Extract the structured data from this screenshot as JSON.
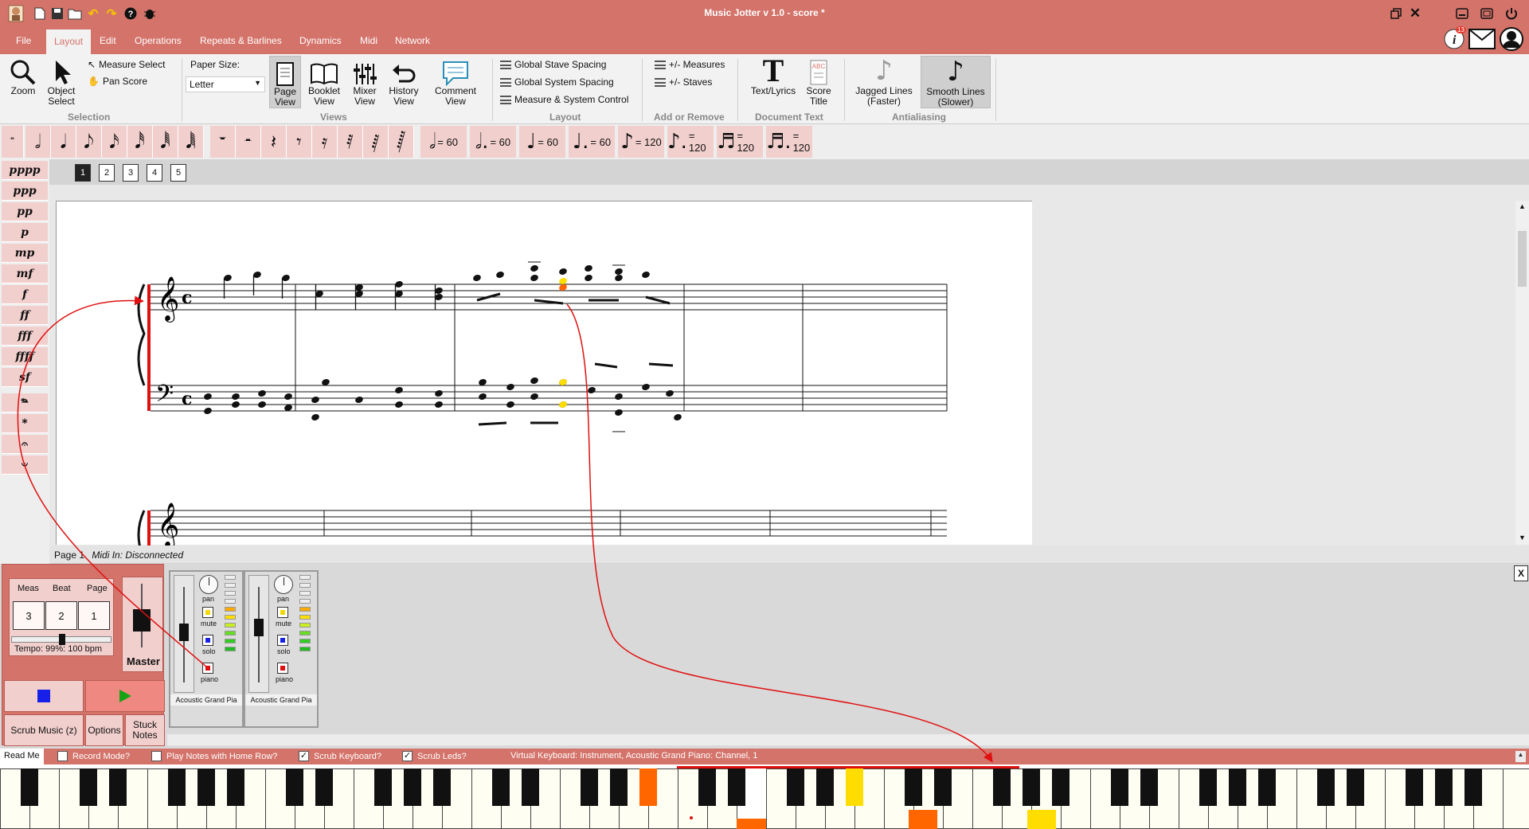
{
  "app": {
    "title": "Music Jotter v 1.0 - score *"
  },
  "menu": {
    "items": [
      "File",
      "Layout",
      "Edit",
      "Operations",
      "Repeats & Barlines",
      "Dynamics",
      "Midi",
      "Network"
    ],
    "active": "Layout"
  },
  "ribbon": {
    "zoom": "Zoom",
    "object_select_1": "Object",
    "object_select_2": "Select",
    "measure_select": "Measure Select",
    "pan_score": "Pan Score",
    "group_selection": "Selection",
    "paper_size_label": "Paper Size:",
    "paper_size_value": "Letter",
    "page_view_1": "Page",
    "page_view_2": "View",
    "booklet_view_1": "Booklet",
    "booklet_view_2": "View",
    "mixer_view_1": "Mixer",
    "mixer_view_2": "View",
    "history_view_1": "History",
    "history_view_2": "View",
    "comment_view_1": "Comment",
    "comment_view_2": "View",
    "group_views": "Views",
    "global_stave_spacing": "Global Stave Spacing",
    "global_system_spacing": "Global System Spacing",
    "measure_system_control": "Measure & System Control",
    "group_layout": "Layout",
    "add_measures": "+/- Measures",
    "add_staves": "+/- Staves",
    "group_add_remove": "Add or Remove",
    "text_lyrics": "Text/Lyrics",
    "score_title_1": "Score",
    "score_title_2": "Title",
    "group_document_text": "Document Text",
    "jagged_1": "Jagged Lines",
    "jagged_2": "(Faster)",
    "smooth_1": "Smooth Lines",
    "smooth_2": "(Slower)",
    "group_antialiasing": "Antialiasing",
    "notification_count": "13"
  },
  "note_strip": {
    "tempos": [
      {
        "glyph": "𝅗𝅥",
        "text": "= 60"
      },
      {
        "glyph": "𝅗𝅥.",
        "text": "= 60"
      },
      {
        "glyph": "♩",
        "text": "= 60"
      },
      {
        "glyph": "♩.",
        "text": "= 60"
      },
      {
        "glyph": "♪",
        "text": "= 120"
      },
      {
        "glyph": "♪.",
        "text": "= 120"
      },
      {
        "glyph": "♬",
        "text": "= 120"
      },
      {
        "glyph": "♬.",
        "text": "= 120"
      }
    ]
  },
  "dynamics": [
    "pppp",
    "ppp",
    "pp",
    "p",
    "mp",
    "mf",
    "f",
    "ff",
    "fff",
    "ffff",
    "sf",
    "𝆮",
    "*",
    "𝄐",
    "𝄑"
  ],
  "pages": [
    "1",
    "2",
    "3",
    "4",
    "5"
  ],
  "status": {
    "page": "Page 1",
    "midi": "Midi In: Disconnected"
  },
  "transport": {
    "meas_label": "Meas",
    "beat_label": "Beat",
    "page_label": "Page",
    "meas": "3",
    "beat": "2",
    "page": "1",
    "tempo_text": "Tempo: 99%: 100 bpm",
    "tempo_fraction": 0.5,
    "master_label": "Master",
    "scrub_music": "Scrub Music (z)",
    "options": "Options",
    "stuck_1": "Stuck",
    "stuck_2": "Notes"
  },
  "mixer": {
    "channels": [
      {
        "name": "Acoustic Grand Pia",
        "pan": "pan",
        "mute": "mute",
        "solo": "solo",
        "instrument": "piano"
      },
      {
        "name": "Acoustic Grand Pia",
        "pan": "pan",
        "mute": "mute",
        "solo": "solo",
        "instrument": "piano"
      }
    ],
    "close": "X"
  },
  "options_bar": {
    "read_me": "Read Me",
    "record_mode": "Record Mode?",
    "play_home_row": "Play Notes with Home Row?",
    "scrub_keyboard": "Scrub Keyboard?",
    "scrub_leds": "Scrub Leds?",
    "virtual_keyboard": "Virtual Keyboard: Instrument, Acoustic Grand Piano: Channel, 1"
  },
  "colors": {
    "accent": "#d4736a",
    "accent_light": "#f1cfcd",
    "highlight_orange": "#ff6600",
    "highlight_yellow": "#ffdd00",
    "arrow_red": "#e01010"
  }
}
